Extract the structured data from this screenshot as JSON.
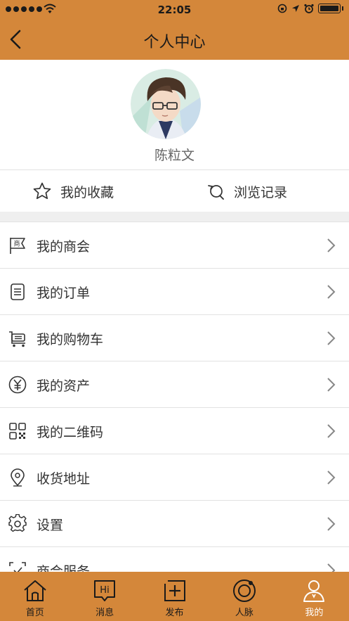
{
  "status_bar": {
    "time": "22:05"
  },
  "nav": {
    "title": "个人中心"
  },
  "profile": {
    "username": "陈粒文"
  },
  "quick_links": [
    {
      "label": "我的收藏",
      "icon": "star-icon"
    },
    {
      "label": "浏览记录",
      "icon": "history-icon"
    }
  ],
  "menu": [
    {
      "label": "我的商会",
      "icon": "chamber-flag-icon"
    },
    {
      "label": "我的订单",
      "icon": "order-list-icon"
    },
    {
      "label": "我的购物车",
      "icon": "cart-icon"
    },
    {
      "label": "我的资产",
      "icon": "yuan-icon"
    },
    {
      "label": "我的二维码",
      "icon": "qr-code-icon"
    },
    {
      "label": "收货地址",
      "icon": "location-pin-icon"
    },
    {
      "label": "设置",
      "icon": "gear-icon"
    },
    {
      "label": "商会服务",
      "icon": "service-icon"
    }
  ],
  "menu_icon_glyph": "商",
  "tabs": [
    {
      "label": "首页",
      "icon": "home-icon",
      "active": false
    },
    {
      "label": "消息",
      "icon": "message-hi-icon",
      "badge_text": "Hi",
      "active": false
    },
    {
      "label": "发布",
      "icon": "publish-plus-icon",
      "active": false
    },
    {
      "label": "人脉",
      "icon": "network-icon",
      "active": false
    },
    {
      "label": "我的",
      "icon": "profile-icon",
      "active": true
    }
  ],
  "colors": {
    "accent": "#d4873a",
    "active_tab_text": "#ffffff"
  }
}
